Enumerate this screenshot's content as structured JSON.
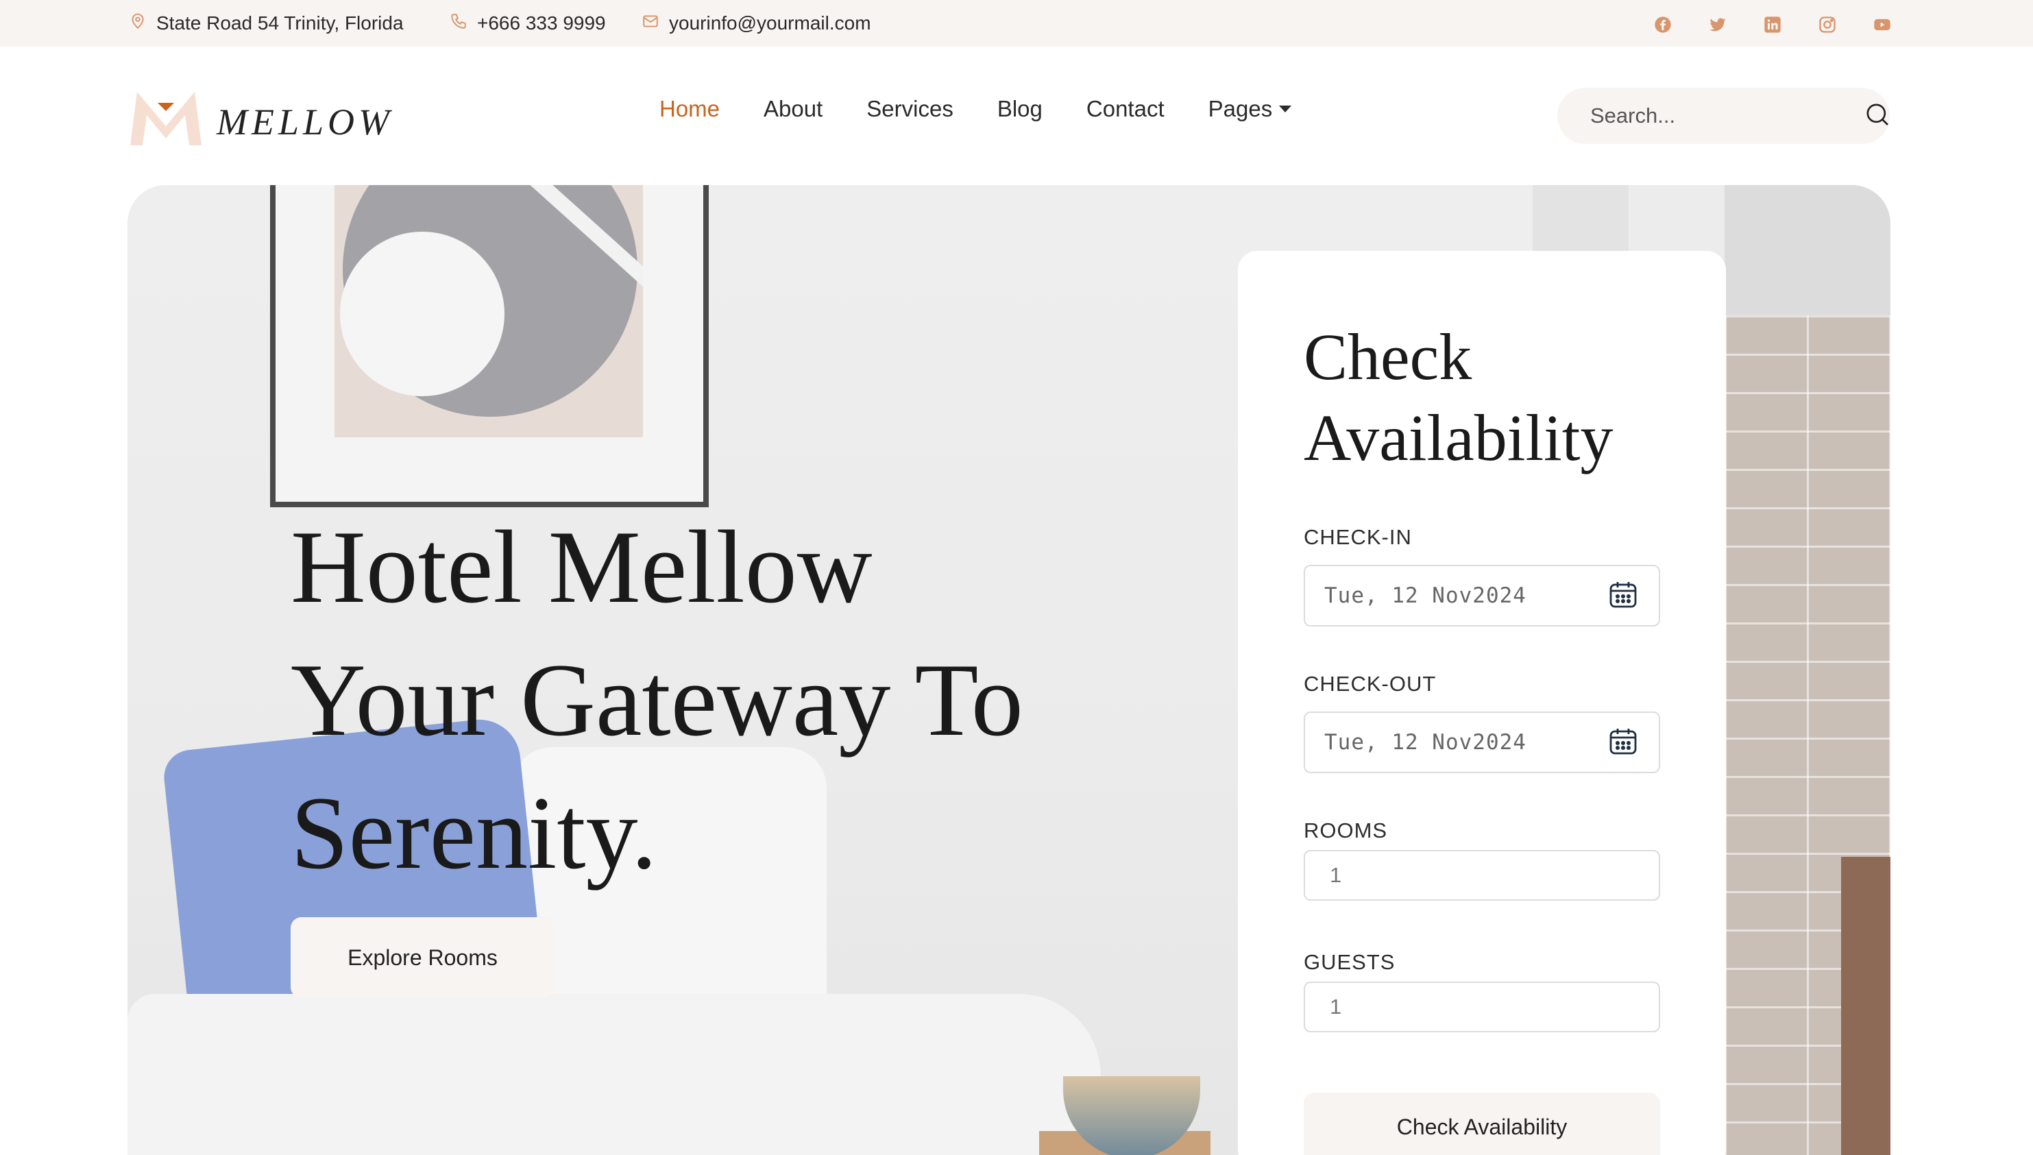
{
  "topbar": {
    "address": "State Road 54 Trinity, Florida",
    "phone": "+666 333 9999",
    "email": "yourinfo@yourmail.com",
    "social_icons": [
      "facebook-icon",
      "twitter-icon",
      "linkedin-icon",
      "instagram-icon",
      "youtube-icon"
    ],
    "icon_color": "#d9956b"
  },
  "brand": {
    "name": "MELLOW",
    "accent": "#c8641d"
  },
  "nav": {
    "items": [
      {
        "label": "Home",
        "active": true
      },
      {
        "label": "About"
      },
      {
        "label": "Services"
      },
      {
        "label": "Blog"
      },
      {
        "label": "Contact"
      },
      {
        "label": "Pages",
        "dropdown": true
      }
    ]
  },
  "search": {
    "placeholder": "Search..."
  },
  "hero": {
    "line1": "Hotel Mellow",
    "line2": "Your Gateway To",
    "line3": "Serenity.",
    "cta": "Explore Rooms"
  },
  "booking": {
    "title_line1": "Check",
    "title_line2": "Availability",
    "checkin_label": "CHECK-IN",
    "checkin_value": "Tue, 12 Nov2024",
    "checkout_label": "CHECK-OUT",
    "checkout_value": "Tue, 12 Nov2024",
    "rooms_label": "ROOMS",
    "rooms_value": "1",
    "guests_label": "GUESTS",
    "guests_value": "1",
    "submit": "Check Availability"
  }
}
